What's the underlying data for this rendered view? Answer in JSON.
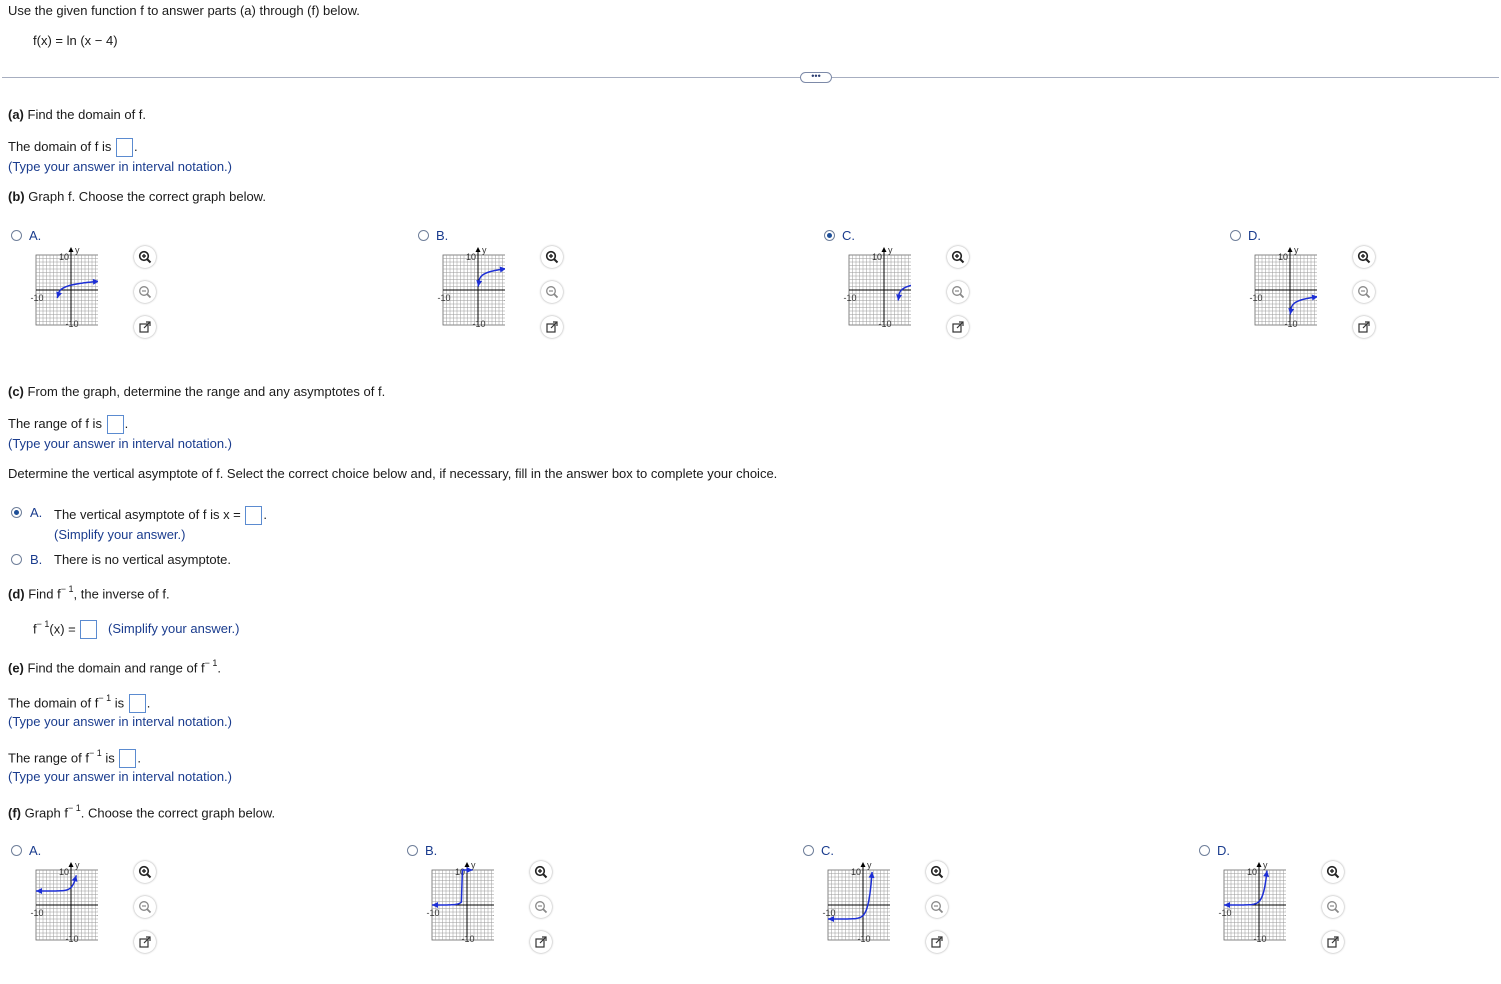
{
  "intro": "Use the given function f to answer parts (a) through (f) below.",
  "function_def": "f(x) = ln (x − 4)",
  "expand_label": "•••",
  "part_a": {
    "prefix": "(a)",
    "question": " Find the domain of f.",
    "answer_text": "The domain of f is",
    "hint": "(Type your answer in interval notation.)"
  },
  "part_b": {
    "prefix": "(b)",
    "question": " Graph f. Choose the correct graph below.",
    "options": [
      {
        "label": "A.",
        "selected": false
      },
      {
        "label": "B.",
        "selected": false
      },
      {
        "label": "C.",
        "selected": true
      },
      {
        "label": "D.",
        "selected": false
      }
    ]
  },
  "part_c": {
    "prefix": "(c)",
    "question": " From the graph, determine the range and any asymptotes of f.",
    "range_text": "The range of f is",
    "hint": "(Type your answer in interval notation.)",
    "asymptote_prompt": "Determine the vertical asymptote of f. Select the correct choice below and, if necessary, fill in the answer box to complete your choice.",
    "choice_a_label": "A.",
    "choice_a_text": "The vertical asymptote of f is x =",
    "choice_a_hint": "(Simplify your answer.)",
    "choice_b_label": "B.",
    "choice_b_text": "There is no vertical asymptote."
  },
  "part_d": {
    "prefix": "(d)",
    "question_pre": " Find f",
    "question_post": ", the inverse of f.",
    "inverse_sup": "− 1",
    "eq_pre": "f",
    "eq_post": "(x) =",
    "hint": "(Simplify your answer.)"
  },
  "part_e": {
    "prefix": "(e)",
    "question_pre": " Find the domain and range of f",
    "sup": "− 1",
    "domain_pre": "The domain of f",
    "domain_post": " is",
    "range_pre": "The range of f",
    "range_post": " is",
    "hint": "(Type your answer in interval notation.)"
  },
  "part_f": {
    "prefix": "(f)",
    "question_pre": " Graph f",
    "question_post": ". Choose the correct graph below.",
    "sup": "− 1",
    "options": [
      {
        "label": "A.",
        "selected": false
      },
      {
        "label": "B.",
        "selected": false
      },
      {
        "label": "C.",
        "selected": false
      },
      {
        "label": "D.",
        "selected": false
      }
    ]
  },
  "graph_labels": {
    "x": "x",
    "y": "y",
    "pos": "10",
    "neg": "-10"
  },
  "icons": [
    "zoom-in-icon",
    "zoom-out-icon",
    "popout-icon"
  ],
  "colors": {
    "curve": "#1d2fd6",
    "radio_selected": "#1e4f98",
    "answer_box": "#5b8bd0"
  }
}
